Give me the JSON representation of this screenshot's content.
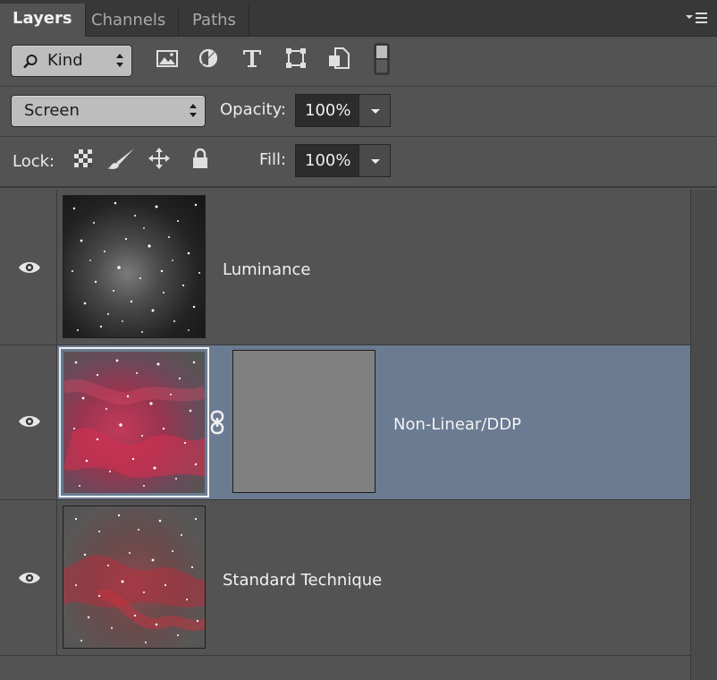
{
  "tabs": [
    {
      "label": "Layers",
      "active": true
    },
    {
      "label": "Channels",
      "active": false
    },
    {
      "label": "Paths",
      "active": false
    }
  ],
  "filter": {
    "kind_label": "Kind",
    "icons": [
      "image-filter-icon",
      "adjustment-filter-icon",
      "type-filter-icon",
      "shape-filter-icon",
      "smart-object-filter-icon",
      "filter-toggle-icon"
    ]
  },
  "blend": {
    "mode": "Screen",
    "opacity_label": "Opacity:",
    "opacity_value": "100%"
  },
  "lock": {
    "label": "Lock:",
    "icons": [
      "lock-transparent-pixels-icon",
      "lock-image-pixels-icon",
      "lock-position-icon",
      "lock-all-icon"
    ],
    "fill_label": "Fill:",
    "fill_value": "100%"
  },
  "layers": [
    {
      "name": "Luminance",
      "visible": true,
      "selected": false,
      "has_mask": false
    },
    {
      "name": "Non-Linear/DDP",
      "visible": true,
      "selected": true,
      "has_mask": true
    },
    {
      "name": "Standard Technique",
      "visible": true,
      "selected": false,
      "has_mask": false
    }
  ],
  "colors": {
    "panel_bg": "#535353",
    "selected_layer_bg": "#6a7b92",
    "field_bg": "#2c2c2c"
  }
}
